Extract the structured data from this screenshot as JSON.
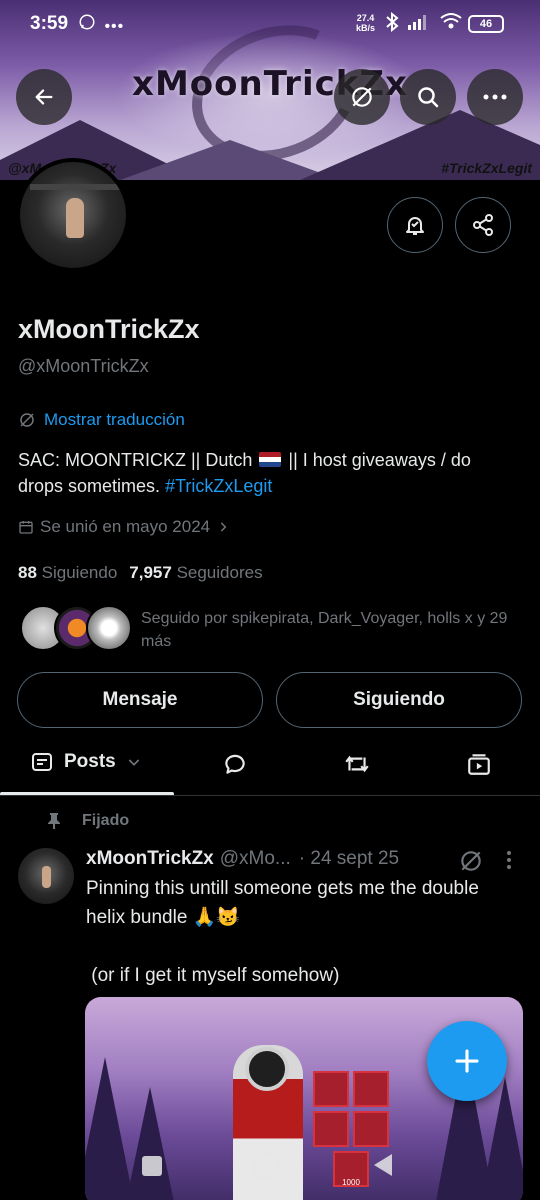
{
  "status_bar": {
    "time": "3:59",
    "net_speed_value": "27.4",
    "net_speed_unit": "kB/s",
    "battery": "46"
  },
  "banner": {
    "title": "xMoonTrickZx",
    "handle_left": "@xMoonTrickZx",
    "handle_right": "#TrickZxLegit"
  },
  "profile": {
    "name": "xMoonTrickZx",
    "handle": "@xMoonTrickZx",
    "translate_label": "Mostrar traducción",
    "bio_before_flag": "SAC: MOONTRICKZ || Dutch",
    "bio_after_flag": " || I host giveaways / do drops sometimes. ",
    "bio_hashtag": "#TrickZxLegit",
    "joined": "Se unió en mayo 2024",
    "following_count": "88",
    "following_label": "Siguiendo",
    "followers_count": "7,957",
    "followers_label": "Seguidores",
    "followed_by": "Seguido por spikepirata, Dark_Voyager, holls x y 29 más"
  },
  "actions": {
    "message_label": "Mensaje",
    "following_button_label": "Siguiendo"
  },
  "tabs": {
    "posts_label": "Posts"
  },
  "post": {
    "pinned_label": "Fijado",
    "author_name": "xMoonTrickZx",
    "author_handle": "@xMo...",
    "date": "· 24 sept 25",
    "text": "Pinning this untill someone gets me the double helix bundle 🙏😼\n\n (or if I get it myself somehow)",
    "media_item_count": "1000"
  },
  "colors": {
    "accent": "#1d9bf0",
    "text_primary": "#e7e9ea",
    "text_secondary": "#71767b",
    "border": "#536471",
    "background": "#000000"
  },
  "icons": [
    "back-arrow-icon",
    "translate-icon",
    "search-icon",
    "more-icon",
    "notification-bell-icon",
    "share-icon",
    "calendar-icon",
    "chevron-right-icon",
    "chevron-down-icon",
    "posts-icon",
    "replies-icon",
    "retweet-icon",
    "media-icon",
    "pin-icon",
    "grok-icon",
    "plus-icon"
  ]
}
